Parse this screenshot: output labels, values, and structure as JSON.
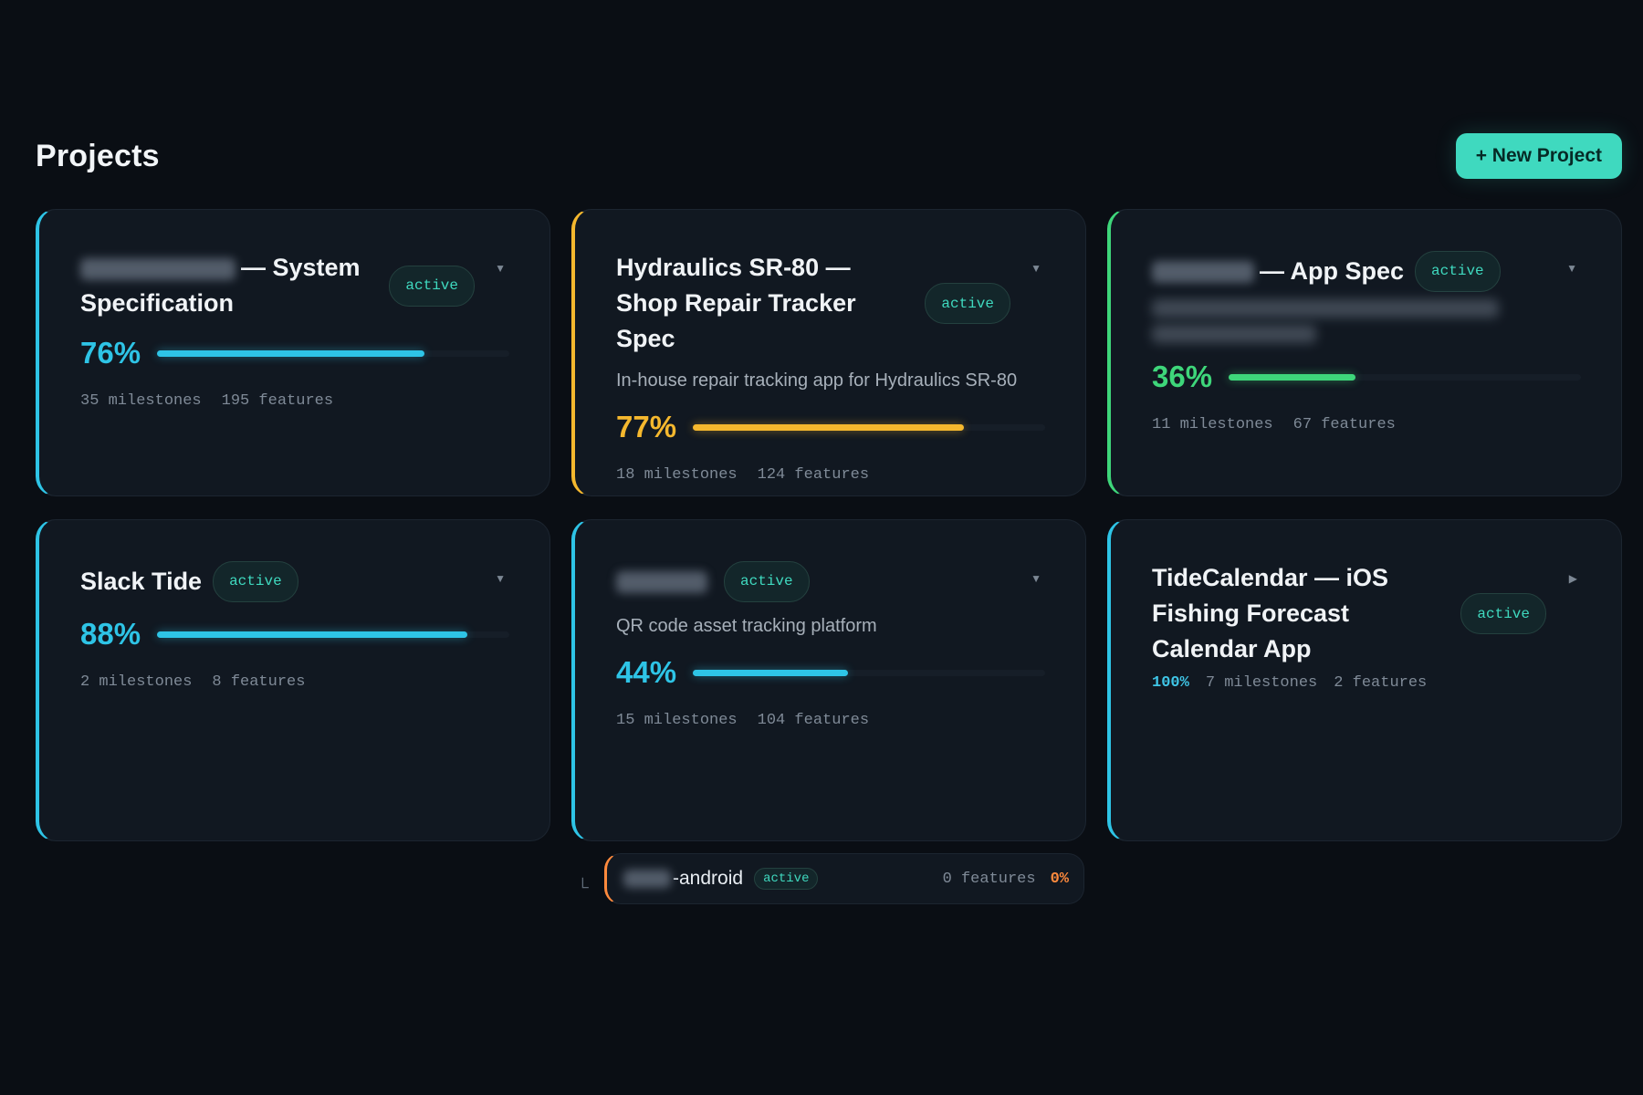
{
  "header": {
    "title": "Projects",
    "new_button": "+ New Project"
  },
  "projects": [
    {
      "title": "— System Specification",
      "blurred_prefix": true,
      "status": "active",
      "percent": "76%",
      "progress": 0.76,
      "milestones": "35 milestones",
      "features": "195 features",
      "accent": "#2ec4e6"
    },
    {
      "title": "Hydraulics SR-80 — Shop Repair Tracker Spec",
      "status": "active",
      "description": "In-house repair tracking app for Hydraulics SR-80",
      "percent": "77%",
      "progress": 0.77,
      "milestones": "18 milestones",
      "features": "124 features",
      "accent": "#f5b82e"
    },
    {
      "title": "— App Spec",
      "blurred_prefix": true,
      "status": "active",
      "description_blurred": true,
      "percent": "36%",
      "progress": 0.36,
      "milestones": "11 milestones",
      "features": "67 features",
      "accent": "#3ed67a"
    },
    {
      "title": "Slack Tide",
      "status": "active",
      "percent": "88%",
      "progress": 0.88,
      "milestones": "2 milestones",
      "features": "8 features",
      "accent": "#2ec4e6"
    },
    {
      "title": "",
      "blurred_prefix": true,
      "status": "active",
      "description": "QR code asset tracking platform",
      "percent": "44%",
      "progress": 0.44,
      "milestones": "15 milestones",
      "features": "104 features",
      "accent": "#2ec4e6"
    },
    {
      "title": "TideCalendar — iOS Fishing Forecast Calendar App",
      "status": "active",
      "percent": "100%",
      "progress": 1.0,
      "milestones": "7 milestones",
      "features": "2 features",
      "accent": "#2ec4e6"
    }
  ],
  "subproject": {
    "name": "-android",
    "status": "active",
    "features": "0 features",
    "percent": "0%"
  },
  "icons": {
    "chevron": "chevron-down-icon",
    "expand": "chevron-right-icon",
    "child": "corner-down-right-icon"
  }
}
